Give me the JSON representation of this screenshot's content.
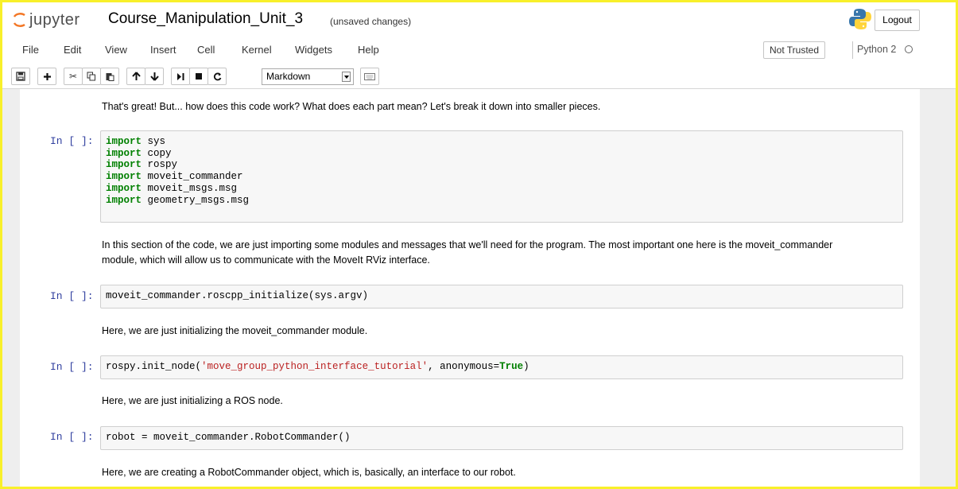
{
  "header": {
    "logo_text": "jupyter",
    "notebook_title": "Course_Manipulation_Unit_3",
    "save_status": "(unsaved changes)",
    "logout_label": "Logout"
  },
  "menu": {
    "items": [
      "File",
      "Edit",
      "View",
      "Insert",
      "Cell",
      "Kernel",
      "Widgets",
      "Help"
    ],
    "trust_label": "Not Trusted",
    "kernel_name": "Python 2"
  },
  "toolbar": {
    "cell_type": "Markdown",
    "icons": [
      "save-icon",
      "add-cell-icon",
      "cut-icon",
      "copy-icon",
      "paste-icon",
      "move-up-icon",
      "move-down-icon",
      "run-icon",
      "stop-icon",
      "restart-icon",
      "keyboard-icon"
    ]
  },
  "cells": [
    {
      "type": "markdown",
      "text": "That's great! But... how does this code work? What does each part mean? Let's break it down into smaller pieces."
    },
    {
      "type": "code",
      "prompt": "In [ ]:",
      "lines": [
        {
          "kw": "import",
          "rest": " sys"
        },
        {
          "kw": "import",
          "rest": " copy"
        },
        {
          "kw": "import",
          "rest": " rospy"
        },
        {
          "kw": "import",
          "rest": " moveit_commander"
        },
        {
          "kw": "import",
          "rest": " moveit_msgs.msg"
        },
        {
          "kw": "import",
          "rest": " geometry_msgs.msg"
        }
      ]
    },
    {
      "type": "markdown",
      "text": "In this section of the code, we are just importing some modules and messages that we'll need for the program. The most important one here is the moveit_commander module, which will allow us to communicate with the MoveIt RViz interface."
    },
    {
      "type": "code",
      "prompt": "In [ ]:",
      "code": "moveit_commander.roscpp_initialize(sys.argv)"
    },
    {
      "type": "markdown",
      "text": "Here, we are just initializing the moveit_commander module."
    },
    {
      "type": "code",
      "prompt": "In [ ]:",
      "code_pre": "rospy.init_node(",
      "code_str": "'move_group_python_interface_tutorial'",
      "code_mid": ", anonymous=",
      "code_kw": "True",
      "code_post": ")"
    },
    {
      "type": "markdown",
      "text": "Here, we are just initializing a ROS node."
    },
    {
      "type": "code",
      "prompt": "In [ ]:",
      "code": "robot = moveit_commander.RobotCommander()"
    },
    {
      "type": "markdown",
      "text": "Here, we are creating a RobotCommander object, which is, basically, an interface to our robot."
    }
  ],
  "colors": {
    "prompt": "#303f9f",
    "keyword": "#008000",
    "string": "#ba2121",
    "frame_highlight": "#f8f02a"
  }
}
